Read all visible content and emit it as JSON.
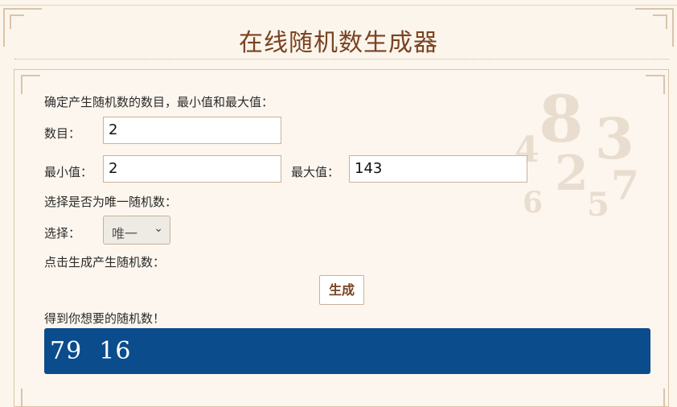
{
  "header": {
    "title": "在线随机数生成器"
  },
  "form": {
    "intro": "确定产生随机数的数目，最小值和最大值：",
    "count": {
      "label": "数目：",
      "value": "2"
    },
    "min": {
      "label": "最小值：",
      "value": "2"
    },
    "max": {
      "label": "最大值：",
      "value": "143"
    },
    "unique_prompt": "选择是否为唯一随机数：",
    "select": {
      "label": "选择：",
      "selected": "唯一"
    },
    "generate_prompt": "点击生成产生随机数：",
    "generate_button": "生成",
    "result_prompt": "得到你想要的随机数！",
    "result": "79  16"
  },
  "colors": {
    "title": "#7a4322",
    "result_bg": "#0b4c8c",
    "page_bg": "#fbf5ec"
  }
}
